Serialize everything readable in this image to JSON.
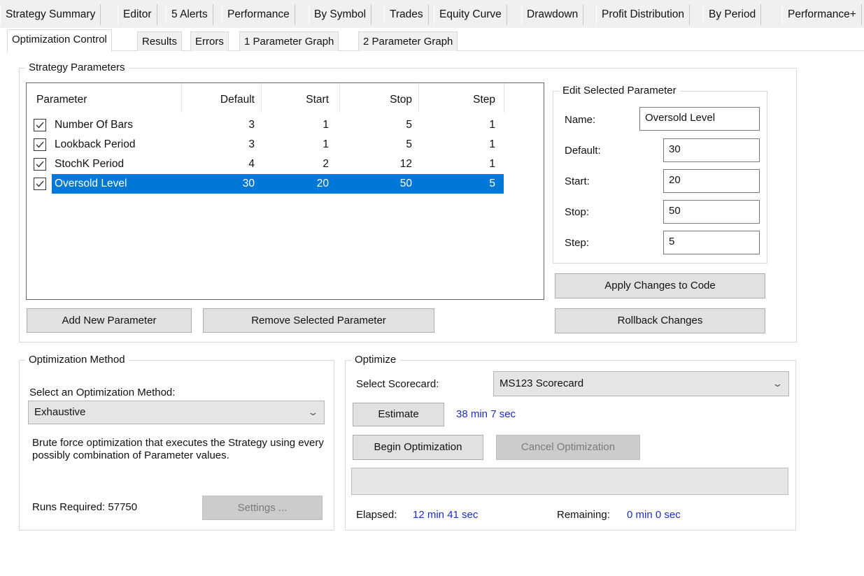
{
  "top_tabs": [
    "Strategy Summary",
    "Editor",
    "5 Alerts",
    "Performance",
    "By Symbol",
    "Trades",
    "Equity Curve",
    "Drawdown",
    "Profit Distribution",
    "By Period",
    "Performance+"
  ],
  "sub_tabs": [
    "Optimization Control",
    "Results",
    "Errors",
    "1 Parameter Graph",
    "2 Parameter Graph"
  ],
  "strategy_parameters": {
    "title": "Strategy Parameters",
    "columns": [
      "Parameter",
      "Default",
      "Start",
      "Stop",
      "Step"
    ],
    "rows": [
      {
        "name": "Number Of Bars",
        "default": "3",
        "start": "1",
        "stop": "5",
        "step": "1",
        "checked": true
      },
      {
        "name": "Lookback Period",
        "default": "3",
        "start": "1",
        "stop": "5",
        "step": "1",
        "checked": true
      },
      {
        "name": "StochK Period",
        "default": "4",
        "start": "2",
        "stop": "12",
        "step": "1",
        "checked": true
      },
      {
        "name": "Oversold Level",
        "default": "30",
        "start": "20",
        "stop": "50",
        "step": "5",
        "checked": true
      }
    ],
    "add_button": "Add New Parameter",
    "remove_button": "Remove Selected Parameter"
  },
  "edit_parameter": {
    "title": "Edit Selected Parameter",
    "name_label": "Name:",
    "name_value": "Oversold Level",
    "default_label": "Default:",
    "default_value": "30",
    "start_label": "Start:",
    "start_value": "20",
    "stop_label": "Stop:",
    "stop_value": "50",
    "step_label": "Step:",
    "step_value": "5",
    "apply_button": "Apply Changes to Code",
    "rollback_button": "Rollback Changes"
  },
  "optimization_method": {
    "title": "Optimization Method",
    "select_label": "Select an Optimization Method:",
    "selected": "Exhaustive",
    "description": "Brute force optimization that executes the Strategy using every possibly combination of Parameter values.",
    "runs_label": "Runs Required: 57750",
    "settings_button": "Settings ..."
  },
  "optimize": {
    "title": "Optimize",
    "scorecard_label": "Select Scorecard:",
    "scorecard_selected": "MS123 Scorecard",
    "estimate_button": "Estimate",
    "estimate_value": "38 min 7 sec",
    "begin_button": "Begin Optimization",
    "cancel_button": "Cancel Optimization",
    "elapsed_label": "Elapsed:",
    "elapsed_value": "12 min 41 sec",
    "remaining_label": "Remaining:",
    "remaining_value": "0 min 0 sec"
  }
}
